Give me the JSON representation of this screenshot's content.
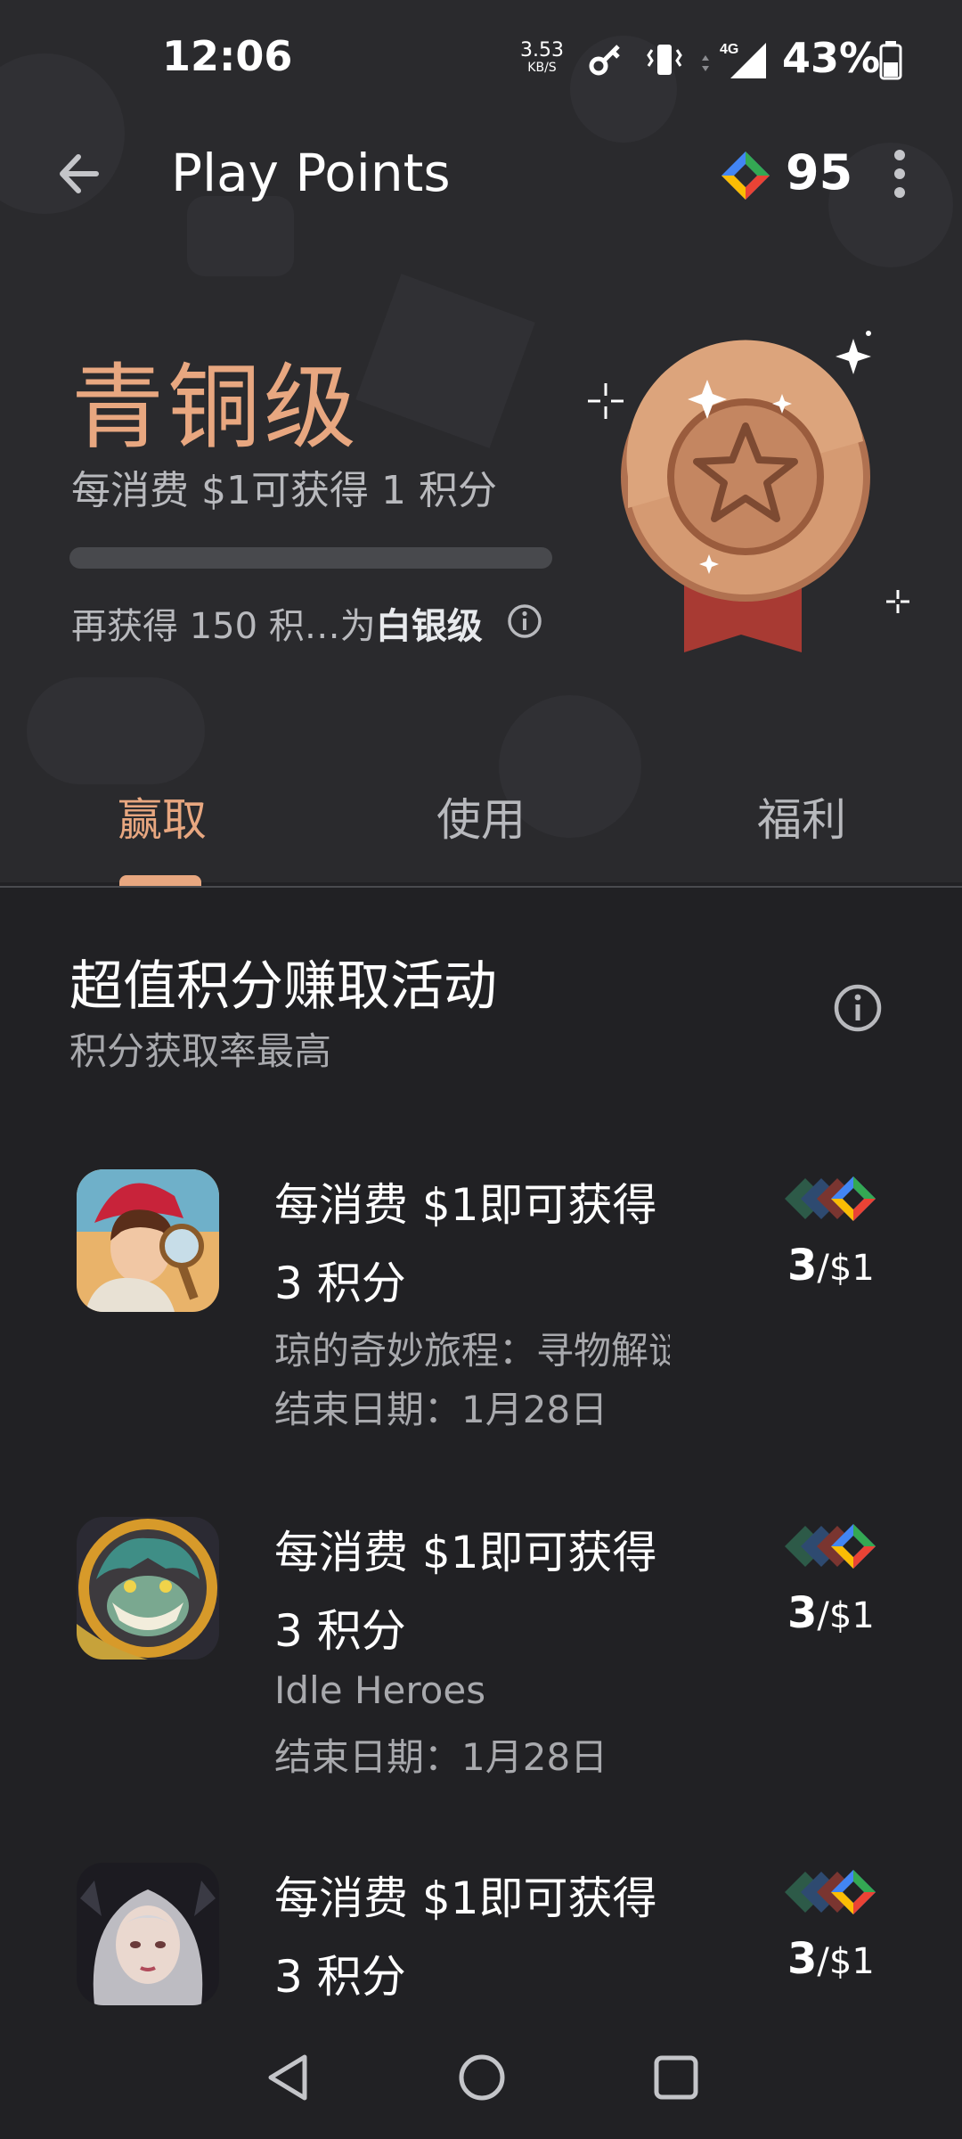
{
  "status_bar": {
    "time": "12:06",
    "net_speed": "3.53",
    "net_speed_unit": "KB/S",
    "network": "4G",
    "battery": "43%"
  },
  "app_bar": {
    "title": "Play Points",
    "points": "95"
  },
  "tier": {
    "name": "青铜级",
    "rate": "每消费 $1可获得 1 积分",
    "progress_fraction": 0.0,
    "next_prefix": "再获得 150 积…为",
    "next_tier": "白银级"
  },
  "tabs": [
    {
      "label": "赢取"
    },
    {
      "label": "使用"
    },
    {
      "label": "福利"
    }
  ],
  "section": {
    "title": "超值积分赚取活动",
    "subtitle": "积分获取率最高"
  },
  "offers": [
    {
      "line1": "每消费 $1即可获得",
      "line2": "3 积分",
      "app_name": "琼的奇妙旅程：寻物解谜",
      "end_date": "结束日期：1月28日",
      "rate_main": "3",
      "rate_unit": "/$1"
    },
    {
      "line1": "每消费 $1即可获得",
      "line2": "3 积分",
      "app_name": "Idle Heroes",
      "end_date": "结束日期：1月28日",
      "rate_main": "3",
      "rate_unit": "/$1"
    },
    {
      "line1": "每消费 $1即可获得",
      "line2": "3 积分",
      "rate_main": "3",
      "rate_unit": "/$1"
    }
  ],
  "colors": {
    "accent": "#e8a780",
    "background": "#212124",
    "hero_background": "#2a2a2d"
  },
  "icons": [
    "back-arrow-icon",
    "play-points-icon",
    "more-vert-icon",
    "info-icon",
    "bronze-medal-icon",
    "nav-back-icon",
    "nav-home-icon",
    "nav-recents-icon"
  ]
}
